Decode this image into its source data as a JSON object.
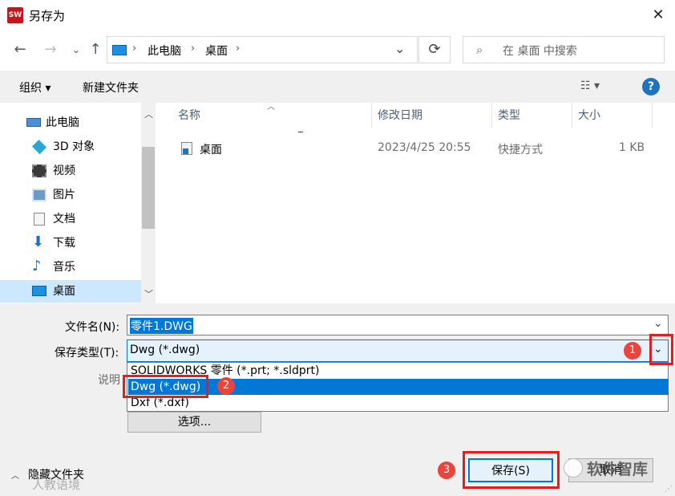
{
  "window": {
    "title": "另存为",
    "app_icon_text": "SW"
  },
  "nav": {
    "breadcrumb": [
      "此电脑",
      "桌面"
    ],
    "search_placeholder": "在 桌面 中搜索"
  },
  "toolbar": {
    "organize": "组织 ▾",
    "new_folder": "新建文件夹"
  },
  "sidebar": {
    "items": [
      {
        "label": "此电脑",
        "icon": "computer-icon"
      },
      {
        "label": "3D 对象",
        "icon": "cube-icon"
      },
      {
        "label": "视频",
        "icon": "video-icon"
      },
      {
        "label": "图片",
        "icon": "picture-icon"
      },
      {
        "label": "文档",
        "icon": "document-icon"
      },
      {
        "label": "下载",
        "icon": "download-icon"
      },
      {
        "label": "音乐",
        "icon": "music-icon"
      },
      {
        "label": "桌面",
        "icon": "desktop-icon",
        "selected": true
      }
    ]
  },
  "filelist": {
    "columns": [
      "名称",
      "修改日期",
      "类型",
      "大小"
    ],
    "rows": [
      {
        "name": "桌面",
        "date": "2023/4/25 20:55",
        "type": "快捷方式",
        "size": "1 KB"
      }
    ]
  },
  "form": {
    "filename_label": "文件名(N):",
    "filename_value": "零件1.DWG",
    "filetype_label": "保存类型(T):",
    "filetype_value": "Dwg (*.dwg)",
    "desc_label": "说明",
    "options": [
      "SOLIDWORKS 零件 (*.prt; *.sldprt)",
      "Dwg (*.dwg)",
      "Dxf (*.dxf)"
    ],
    "options_button": "选项...",
    "hide_folders": "隐藏文件夹",
    "save_button": "保存(S)",
    "cancel_button": "取消"
  },
  "annotations": {
    "badge1": "1",
    "badge2": "2",
    "badge3": "3"
  },
  "watermark": {
    "left": "人教语境",
    "right": "软件智库"
  },
  "colors": {
    "accent": "#0078d7",
    "highlight_red": "#e02020",
    "badge": "#e8453c"
  }
}
